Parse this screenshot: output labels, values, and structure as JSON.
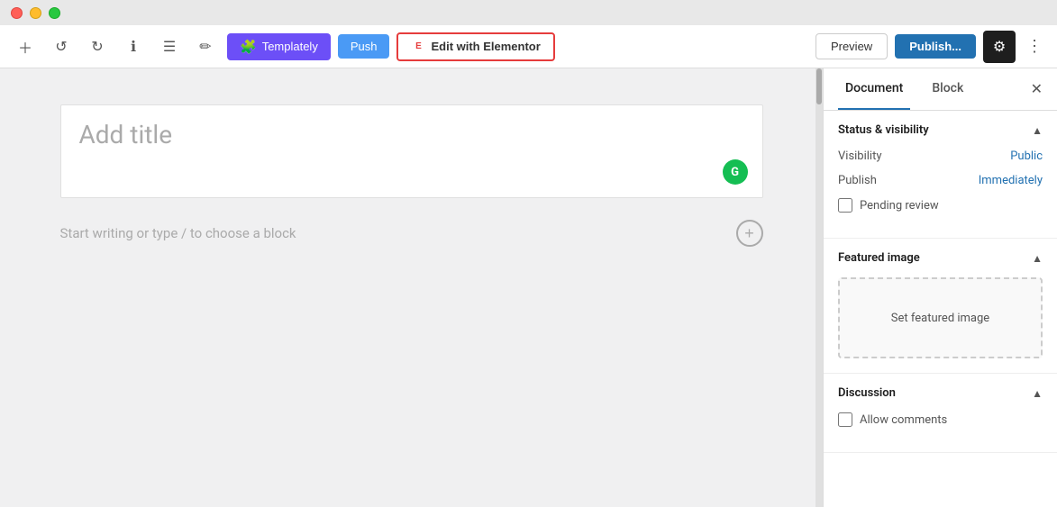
{
  "titleBar": {
    "trafficLights": [
      "red",
      "yellow",
      "green"
    ]
  },
  "toolbar": {
    "undoLabel": "↺",
    "redoLabel": "↻",
    "infoLabel": "ℹ",
    "listLabel": "☰",
    "penLabel": "✏",
    "templatley_label": "Templately",
    "push_label": "Push",
    "elementor_label": "Edit with Elementor",
    "preview_label": "Preview",
    "publish_label": "Publish...",
    "settings_label": "⚙",
    "more_label": "⋮"
  },
  "editor": {
    "title_placeholder": "Add title",
    "write_placeholder": "Start writing or type / to choose a block"
  },
  "sidebar": {
    "tab_document": "Document",
    "tab_block": "Block",
    "sections": {
      "status_visibility": {
        "title": "Status & visibility",
        "visibility_label": "Visibility",
        "visibility_value": "Public",
        "publish_label": "Publish",
        "publish_value": "Immediately",
        "pending_review_label": "Pending review"
      },
      "featured_image": {
        "title": "Featured image",
        "set_label": "Set featured image"
      },
      "discussion": {
        "title": "Discussion",
        "allow_comments_label": "Allow comments"
      }
    }
  }
}
